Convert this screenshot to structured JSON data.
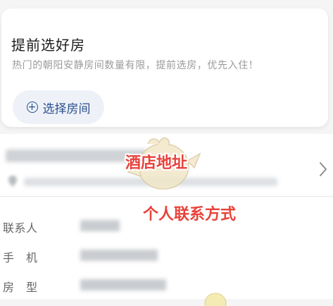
{
  "room_card": {
    "title": "提前选好房",
    "description": "热门的朝阳安静房间数量有限，提前选房，优先入住！",
    "select_button": {
      "icon": "plus-circle-icon",
      "label": "选择房间"
    }
  },
  "hotel_info": {
    "chevron_icon": "chevron-right-icon",
    "contact_rows": [
      {
        "label": "联系人"
      },
      {
        "label": "手　机"
      },
      {
        "label": "房　型"
      }
    ]
  },
  "annotations": {
    "hotel_address": "酒店地址",
    "contact_info": "个人联系方式"
  },
  "colors": {
    "accent": "#2a4f8c",
    "button_bg": "#eef2f8",
    "annotation_red": "#e8423a"
  }
}
